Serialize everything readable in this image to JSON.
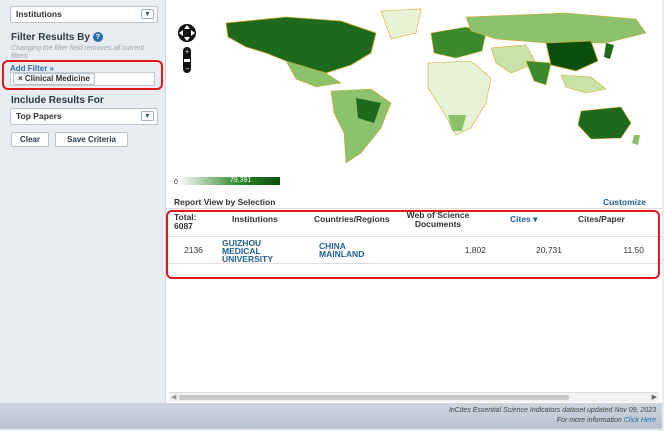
{
  "sidebar": {
    "top_select": "Institutions",
    "filter_title": "Filter Results By",
    "filter_note": "Changing the filter field removes all current filters",
    "add_filter": "Add Filter »",
    "filter_chip": "× Clinical Medicine",
    "include_title": "Include Results For",
    "include_select": "Top Papers",
    "clear_label": "Clear",
    "save_label": "Save Criteria"
  },
  "map": {
    "legend_min": "0",
    "legend_max": "79,391",
    "colors": {
      "ocean": "#ffffff",
      "land_light": "#e8f2d7",
      "land_mid": "#8cc26b",
      "land_dark": "#1d6a1d",
      "border": "#d4a92b"
    }
  },
  "report": {
    "title": "Report View by Selection",
    "customize": "Customize",
    "total_label": "Total:",
    "total_value": "6087",
    "columns": [
      "Institutions",
      "Countries/Regions",
      "Web of Science Documents",
      "Cites ▾",
      "Cites/Paper"
    ],
    "rows": [
      {
        "rank": "2136",
        "institution": "GUIZHOU MEDICAL UNIVERSITY",
        "country": "CHINA MAINLAND",
        "documents": "1,802",
        "cites": "20,731",
        "cites_per_paper": "11.50"
      }
    ]
  },
  "footer": {
    "line1": "InCites Essential Science Indicators dataset updated Nov 09, 2023",
    "line2": "For more information",
    "link": "Click Here"
  },
  "accent": "#1f5f94",
  "highlight": "#e0191b"
}
